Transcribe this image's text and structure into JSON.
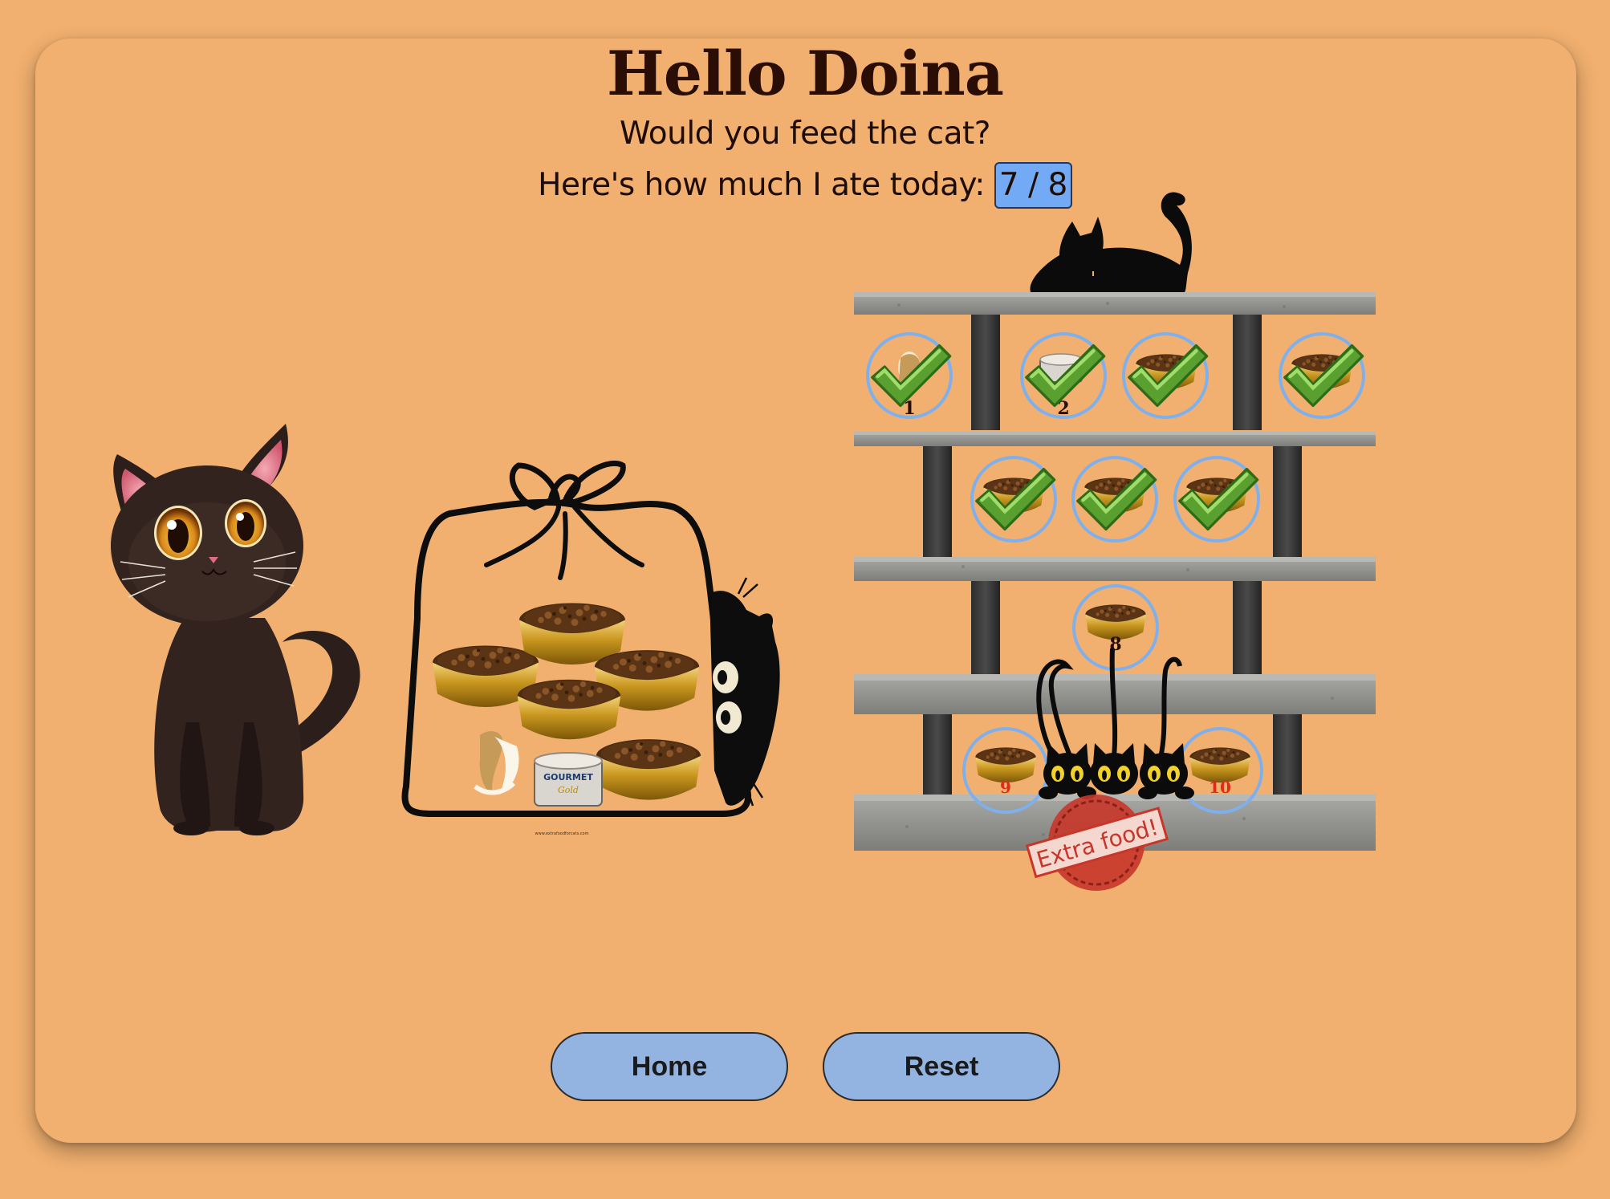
{
  "page": {
    "title": "Hello Doina",
    "question": "Would you feed the cat?",
    "progress_label": "Here's how much I ate today: ",
    "progress_value": "7 / 8",
    "eaten": 7,
    "goal": 8
  },
  "bag": {
    "brand_text": "GOURMET",
    "sub_text": "Gold",
    "footer_text": "www.extrafoodforcats.com"
  },
  "bowls": [
    {
      "number": "1",
      "food": "milk",
      "checked": true
    },
    {
      "number": "2",
      "food": "can",
      "checked": true
    },
    {
      "number": "",
      "food": "kibble",
      "checked": true
    },
    {
      "number": "",
      "food": "kibble",
      "checked": true
    },
    {
      "number": "",
      "food": "kibble",
      "checked": true
    },
    {
      "number": "",
      "food": "kibble",
      "checked": true
    },
    {
      "number": "",
      "food": "kibble",
      "checked": true
    },
    {
      "number": "8",
      "food": "kibble",
      "checked": false
    },
    {
      "number": "9",
      "food": "kibble",
      "checked": false,
      "extra": true
    },
    {
      "number": "10",
      "food": "kibble",
      "checked": false,
      "extra": true
    }
  ],
  "stamp": {
    "text": "Extra food!"
  },
  "buttons": {
    "home": "Home",
    "reset": "Reset"
  },
  "colors": {
    "background": "#f1b06f",
    "button": "#93b4e0",
    "counter": "#72aaf6",
    "check": "#6cb33f",
    "stamp": "#d23a2c"
  }
}
